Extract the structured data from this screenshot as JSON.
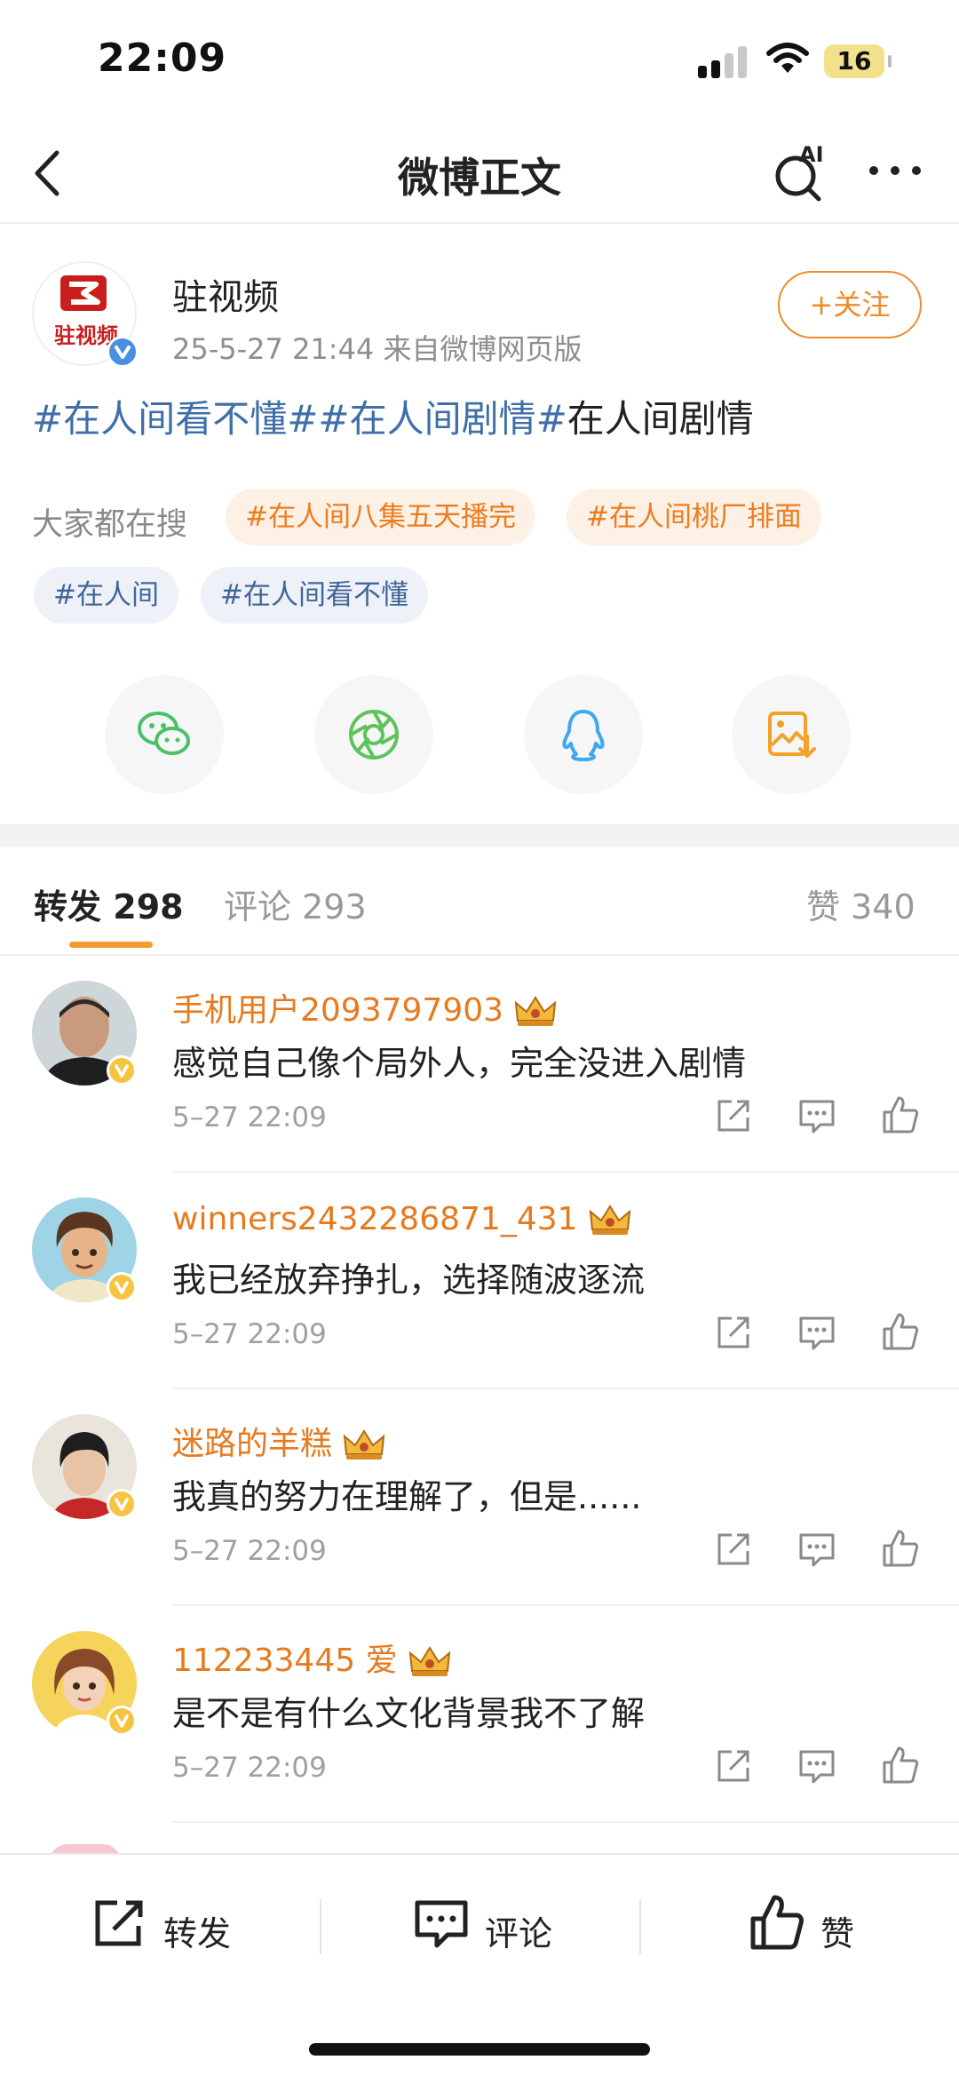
{
  "status_bar": {
    "time": "22:09",
    "battery": "16"
  },
  "nav": {
    "title": "微博正文",
    "ai_label": "AI"
  },
  "post": {
    "author": "驻视频",
    "avatar_text": "驻视频",
    "meta": "25-5-27 21:44  来自微博网页版",
    "follow_label": "+关注",
    "text_topic_1": "#在人间看不懂#",
    "text_topic_2": "#在人间剧情#",
    "text_plain": "在人间剧情"
  },
  "hot_search": {
    "label": "大家都在搜",
    "chips": [
      "#在人间八集五天播完",
      "#在人间桃厂排面",
      "#在人间",
      "#在人间看不懂"
    ]
  },
  "share_icons": [
    "wechat-icon",
    "moments-icon",
    "qq-icon",
    "save-image-icon"
  ],
  "tabs": [
    {
      "label": "转发",
      "count": "298"
    },
    {
      "label": "评论",
      "count": "293"
    },
    {
      "label": "赞",
      "count": "340"
    }
  ],
  "comments": [
    {
      "user": "手机用户2093797903",
      "text": "感觉自己像个局外人，完全没进入剧情",
      "time": "5–27 22:09"
    },
    {
      "user": "winners2432286871_431",
      "text": "我已经放弃挣扎，选择随波逐流",
      "time": "5–27 22:09"
    },
    {
      "user": "迷路的羊糕",
      "text": "我真的努力在理解了，但是......",
      "time": "5–27 22:09"
    },
    {
      "user": "112233445 爱",
      "text": "是不是有什么文化背景我不了解",
      "time": "5–27 22:09"
    }
  ],
  "bottom_bar": {
    "repost": "转发",
    "comment": "评论",
    "like": "赞"
  },
  "colors": {
    "accent": "#f08a2a",
    "topic": "#3f6fa8",
    "username": "#e67a1f",
    "verified": "#4a90e2",
    "vip": "#f5c542"
  }
}
